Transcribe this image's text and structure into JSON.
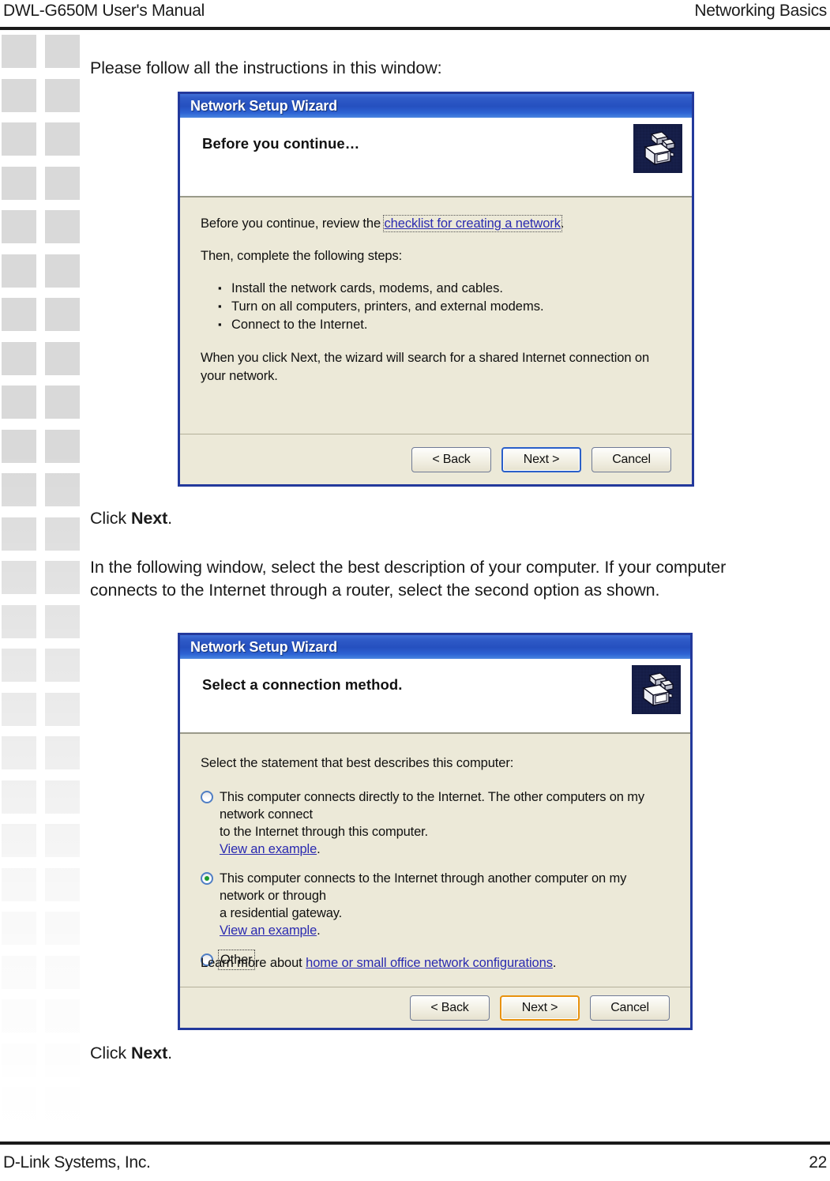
{
  "page": {
    "header_left": "DWL-G650M User's Manual",
    "header_right": "Networking Basics",
    "footer_left": "D-Link Systems, Inc.",
    "footer_page_number": "22"
  },
  "body": {
    "intro": "Please follow all the instructions in this window:",
    "click_next_1_prefix": "Click ",
    "click_next_1_bold": "Next",
    "click_next_1_suffix": ".",
    "paragraph_2_line1": "In the following window, select the best description of your computer. If your computer",
    "paragraph_2_line2": "connects to the Internet through a router, select the second option as shown.",
    "click_next_2_prefix": "Click ",
    "click_next_2_bold": "Next",
    "click_next_2_suffix": "."
  },
  "dialog1": {
    "title": "Network Setup Wizard",
    "heading": "Before you continue…",
    "icon": "network-computers-icon",
    "intro_prefix": "Before you continue, review the ",
    "intro_link": "checklist for creating a network",
    "intro_suffix": ".",
    "then_line": "Then, complete the following steps:",
    "steps": [
      "Install the network cards, modems, and cables.",
      "Turn on all computers, printers, and external modems.",
      "Connect to the Internet."
    ],
    "closing": "When you click Next, the wizard will search for a shared Internet connection on your network.",
    "buttons": {
      "back": "< Back",
      "back_accel": "B",
      "next": "Next >",
      "next_accel": "N",
      "cancel": "Cancel",
      "focused": "next",
      "focus_color": "#2a5fc9"
    }
  },
  "dialog2": {
    "title": "Network Setup Wizard",
    "heading": "Select a connection method.",
    "icon": "network-computers-icon",
    "prompt": "Select the statement that best describes this computer:",
    "options": [
      {
        "selected": false,
        "line1": "This computer connects directly to the Internet. The other computers on my network connect",
        "line2": "to the Internet through this computer.",
        "link": "View an example",
        "link_suffix": ".",
        "accel": "c"
      },
      {
        "selected": true,
        "line1": "This computer connects to the Internet through another computer on my network or through",
        "line2": "a residential gateway.",
        "link": "View an example",
        "link_suffix": ".",
        "accel": "m"
      },
      {
        "selected": false,
        "line1": "Other",
        "line2": "",
        "link": "",
        "link_suffix": "",
        "accel": "O",
        "focused": true
      }
    ],
    "learn_more_prefix": "Learn more about ",
    "learn_more_link": "home or small office network configurations",
    "learn_more_suffix": ".",
    "buttons": {
      "back": "< Back",
      "back_accel": "B",
      "next": "Next >",
      "next_accel": "N",
      "cancel": "Cancel",
      "focused": "next",
      "focus_color": "#e8920f"
    }
  },
  "colors": {
    "titlebar_blue": "#2550bf",
    "dialog_border": "#23399c",
    "dialog_bg": "#ece9d8",
    "link_blue": "#2a2ab0",
    "radio_selected_green": "#1d9b2e",
    "margin_square_gray": "#d9d9d9"
  }
}
